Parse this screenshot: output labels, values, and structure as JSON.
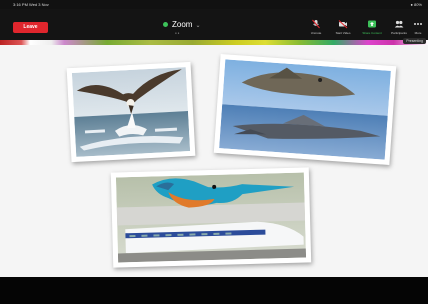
{
  "status_bar": {
    "time": "3:16 PM  Wed 3 Nov",
    "battery": "80%"
  },
  "toolbar": {
    "leave_label": "Leave",
    "title": "Zoom",
    "subtitle": "● ●",
    "items": [
      {
        "label": "Unmute",
        "icon": "mic-off-icon"
      },
      {
        "label": "Start Video",
        "icon": "video-off-icon"
      },
      {
        "label": "Share Content",
        "icon": "share-screen-icon"
      },
      {
        "label": "Participants",
        "icon": "participants-icon"
      },
      {
        "label": "More",
        "icon": "more-icon"
      }
    ]
  },
  "share_badge": "Presenting",
  "colors": {
    "leave": "#e0262d",
    "share_active": "#3dc25a",
    "toolbar": "#141414",
    "canvas": "#f5f5f5"
  }
}
